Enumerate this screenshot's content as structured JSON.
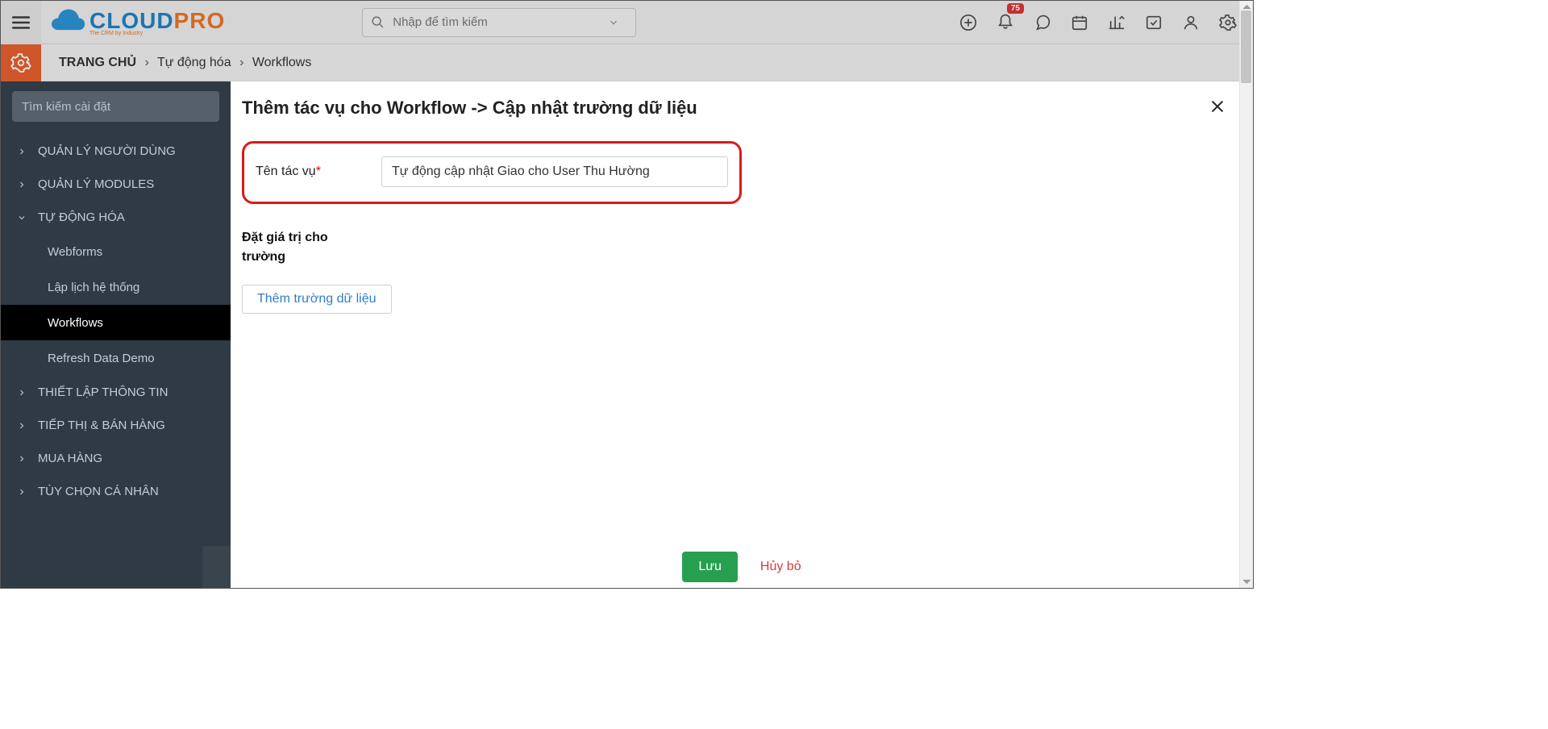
{
  "header": {
    "logo_main": "CLOUD",
    "logo_accent": "PRO",
    "logo_tag": "The CRM by Industry",
    "search_placeholder": "Nhập để tìm kiếm",
    "notif_badge": "75"
  },
  "breadcrumb": {
    "home": "TRANG CHỦ",
    "lvl1": "Tự động hóa",
    "lvl2": "Workflows"
  },
  "sidebar": {
    "search_placeholder": "Tìm kiếm cài đặt",
    "items": [
      "QUẢN LÝ NGƯỜI DÙNG",
      "QUẢN LÝ MODULES",
      "TỰ ĐỘNG HÓA",
      "THIẾT LẬP THÔNG TIN",
      "TIẾP THỊ & BÁN HÀNG",
      "MUA HÀNG",
      "TÙY CHỌN CÁ NHÂN"
    ],
    "subitems": [
      "Webforms",
      "Lập lịch hệ thống",
      "Workflows",
      "Refresh Data Demo"
    ]
  },
  "modal": {
    "title": "Thêm tác vụ cho Workflow -> Cập nhật trường dữ liệu",
    "task_name_label": "Tên tác vụ",
    "task_name_value": "Tự động cập nhật Giao cho User Thu Hường",
    "section_label": "Đặt giá trị cho trường",
    "add_field": "Thêm trường dữ liệu",
    "save": "Lưu",
    "cancel": "Hủy bỏ"
  }
}
